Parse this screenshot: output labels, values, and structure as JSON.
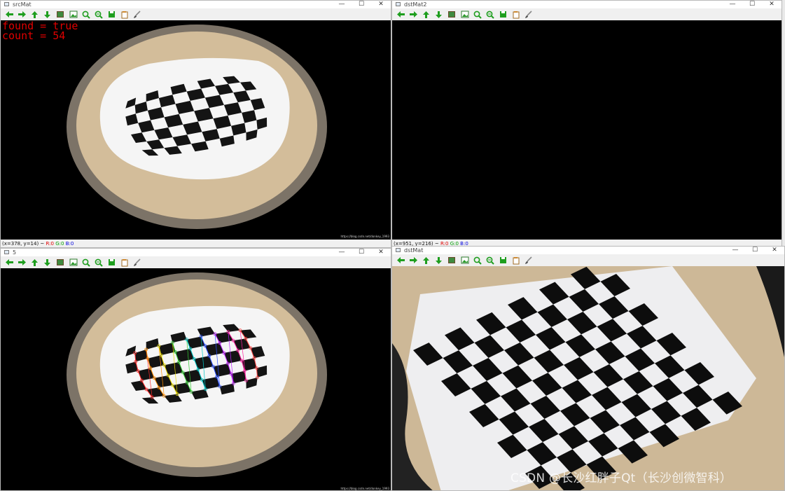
{
  "windows": {
    "src": {
      "title": "srcMat",
      "overlay_lines": [
        "found = true",
        "count = 54"
      ],
      "status": {
        "coord": "(x=378, y=14) ~",
        "r": "R:0",
        "g": "G:0",
        "b": "B:0"
      },
      "credit": "https://blog.csdn.net/donkey_1993"
    },
    "dst2": {
      "title": "dstMat2",
      "status": {
        "coord": "(x=951, y=216) ~",
        "r": "R:0",
        "g": "G:0",
        "b": "B:0"
      }
    },
    "s5": {
      "title": "5",
      "credit": "https://blog.csdn.net/donkey_1993"
    },
    "dst": {
      "title": "dstMat"
    }
  },
  "window_controls": {
    "minimize": "—",
    "maximize": "☐",
    "close": "✕"
  },
  "toolbar_icons": [
    "arrow-left-icon",
    "arrow-right-icon",
    "arrow-up-icon",
    "arrow-down-icon",
    "image-icon",
    "picture-icon",
    "zoom-in-icon",
    "zoom-out-icon",
    "save-icon",
    "copy-icon",
    "brush-icon"
  ],
  "colors": {
    "overlay_text": "#e00000",
    "status_r": "#e00000",
    "status_g": "#00a000",
    "status_b": "#0000e0",
    "toolbar_green": "#1e9e1e"
  },
  "watermark": "CSDN @长沙红胖子Qt（长沙创微智科）"
}
